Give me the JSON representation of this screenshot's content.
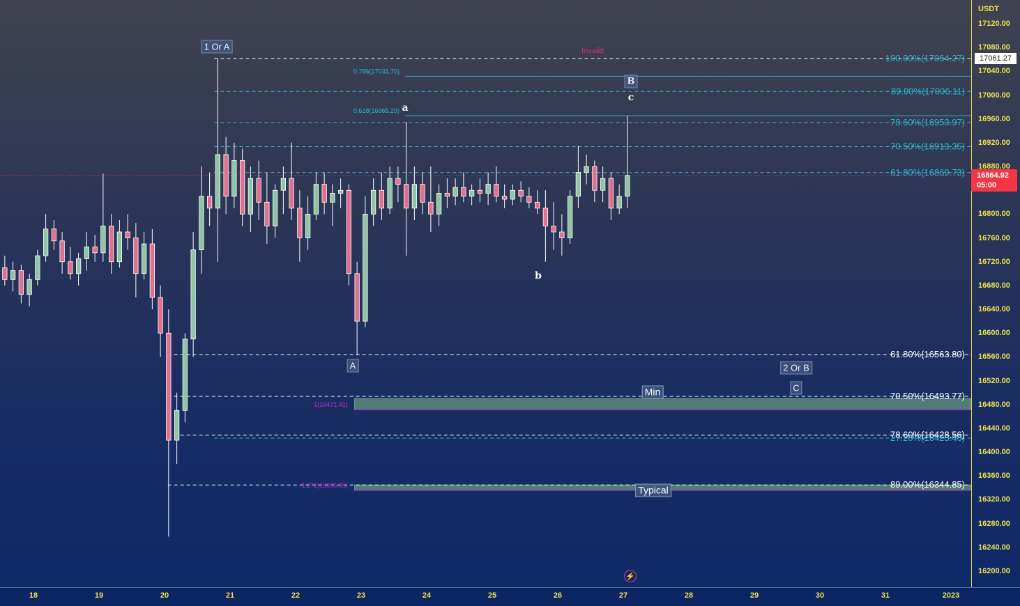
{
  "chart_data": {
    "type": "candlestick",
    "currency": "USDT",
    "candle_interval_days": 0.125,
    "first_candle_start_day": 17.5,
    "ohlc": [
      [
        16710,
        16730,
        16680,
        16690
      ],
      [
        16690,
        16720,
        16670,
        16705
      ],
      [
        16705,
        16715,
        16650,
        16665
      ],
      [
        16665,
        16700,
        16645,
        16690
      ],
      [
        16690,
        16740,
        16680,
        16730
      ],
      [
        16730,
        16800,
        16720,
        16775
      ],
      [
        16775,
        16790,
        16740,
        16755
      ],
      [
        16755,
        16770,
        16700,
        16720
      ],
      [
        16720,
        16745,
        16690,
        16700
      ],
      [
        16700,
        16735,
        16680,
        16725
      ],
      [
        16725,
        16770,
        16705,
        16745
      ],
      [
        16745,
        16765,
        16720,
        16735
      ],
      [
        16735,
        16868,
        16720,
        16780
      ],
      [
        16780,
        16800,
        16700,
        16720
      ],
      [
        16720,
        16790,
        16710,
        16770
      ],
      [
        16770,
        16800,
        16740,
        16760
      ],
      [
        16760,
        16785,
        16660,
        16700
      ],
      [
        16700,
        16770,
        16690,
        16750
      ],
      [
        16750,
        16775,
        16640,
        16660
      ],
      [
        16660,
        16680,
        16560,
        16600
      ],
      [
        16600,
        16640,
        16258,
        16420
      ],
      [
        16420,
        16500,
        16380,
        16470
      ],
      [
        16470,
        16600,
        16450,
        16590
      ],
      [
        16590,
        16770,
        16560,
        16740
      ],
      [
        16740,
        16880,
        16700,
        16830
      ],
      [
        16830,
        16870,
        16780,
        16810
      ],
      [
        16810,
        17061,
        16720,
        16900
      ],
      [
        16900,
        16930,
        16800,
        16830
      ],
      [
        16830,
        16920,
        16810,
        16890
      ],
      [
        16890,
        16910,
        16780,
        16800
      ],
      [
        16800,
        16880,
        16770,
        16860
      ],
      [
        16860,
        16890,
        16790,
        16820
      ],
      [
        16820,
        16870,
        16750,
        16780
      ],
      [
        16780,
        16850,
        16760,
        16840
      ],
      [
        16840,
        16880,
        16800,
        16860
      ],
      [
        16860,
        16920,
        16790,
        16810
      ],
      [
        16810,
        16840,
        16720,
        16760
      ],
      [
        16760,
        16830,
        16740,
        16800
      ],
      [
        16800,
        16870,
        16790,
        16850
      ],
      [
        16850,
        16870,
        16800,
        16820
      ],
      [
        16820,
        16850,
        16780,
        16835
      ],
      [
        16835,
        16860,
        16810,
        16840
      ],
      [
        16840,
        16850,
        16680,
        16700
      ],
      [
        16700,
        16720,
        16563,
        16620
      ],
      [
        16620,
        16830,
        16610,
        16800
      ],
      [
        16800,
        16860,
        16780,
        16840
      ],
      [
        16840,
        16870,
        16790,
        16810
      ],
      [
        16810,
        16880,
        16800,
        16860
      ],
      [
        16860,
        16880,
        16820,
        16850
      ],
      [
        16850,
        16955,
        16730,
        16810
      ],
      [
        16810,
        16880,
        16790,
        16850
      ],
      [
        16850,
        16870,
        16800,
        16820
      ],
      [
        16820,
        16880,
        16770,
        16800
      ],
      [
        16800,
        16850,
        16780,
        16835
      ],
      [
        16835,
        16860,
        16810,
        16830
      ],
      [
        16830,
        16860,
        16815,
        16845
      ],
      [
        16845,
        16870,
        16820,
        16830
      ],
      [
        16830,
        16850,
        16815,
        16840
      ],
      [
        16840,
        16860,
        16820,
        16835
      ],
      [
        16835,
        16870,
        16815,
        16850
      ],
      [
        16850,
        16880,
        16820,
        16830
      ],
      [
        16830,
        16850,
        16810,
        16825
      ],
      [
        16825,
        16850,
        16815,
        16840
      ],
      [
        16840,
        16855,
        16820,
        16830
      ],
      [
        16830,
        16845,
        16810,
        16820
      ],
      [
        16820,
        16840,
        16800,
        16810
      ],
      [
        16810,
        16840,
        16720,
        16780
      ],
      [
        16780,
        16820,
        16740,
        16770
      ],
      [
        16770,
        16800,
        16730,
        16760
      ],
      [
        16760,
        16840,
        16750,
        16830
      ],
      [
        16830,
        16915,
        16810,
        16870
      ],
      [
        16870,
        16900,
        16850,
        16880
      ],
      [
        16880,
        16890,
        16820,
        16840
      ],
      [
        16840,
        16880,
        16820,
        16860
      ],
      [
        16860,
        16870,
        16790,
        16810
      ],
      [
        16810,
        16850,
        16800,
        16830
      ],
      [
        16830,
        16965,
        16810,
        16864.92
      ]
    ],
    "ylim": [
      16180,
      17150
    ],
    "y_ticks": [
      "17120.00",
      "17080.00",
      "17040.00",
      "17000.00",
      "16960.00",
      "16920.00",
      "16880.00",
      "16800.00",
      "16760.00",
      "16720.00",
      "16680.00",
      "16640.00",
      "16600.00",
      "16560.00",
      "16520.00",
      "16480.00",
      "16440.00",
      "16400.00",
      "16360.00",
      "16320.00",
      "16280.00",
      "16240.00",
      "16200.00"
    ],
    "x_ticks": [
      {
        "label": "18",
        "day": 18
      },
      {
        "label": "19",
        "day": 19
      },
      {
        "label": "20",
        "day": 20
      },
      {
        "label": "21",
        "day": 21
      },
      {
        "label": "22",
        "day": 22
      },
      {
        "label": "23",
        "day": 23
      },
      {
        "label": "24",
        "day": 24
      },
      {
        "label": "25",
        "day": 25
      },
      {
        "label": "26",
        "day": 26
      },
      {
        "label": "27",
        "day": 27
      },
      {
        "label": "28",
        "day": 28
      },
      {
        "label": "29",
        "day": 29
      },
      {
        "label": "30",
        "day": 30
      },
      {
        "label": "31",
        "day": 31
      },
      {
        "label": "2023",
        "day": 32
      }
    ],
    "levels": [
      {
        "label": "100.00%(17064.27)",
        "price": 17061.27,
        "from_day": 20.76,
        "style": "dashed",
        "color": "#ffffff",
        "label_color": "#2bb7c9",
        "label_side": "right"
      },
      {
        "label": "89.00%(17006.11)",
        "price": 17006.11,
        "from_day": 20.76,
        "style": "dashed",
        "color": "#2bb7c9",
        "label_color": "#2bb7c9",
        "label_side": "right"
      },
      {
        "label": "78.60%(16953.97)",
        "price": 16953.97,
        "from_day": 20.76,
        "style": "dashed",
        "color": "#2bb7c9",
        "label_color": "#2bb7c9",
        "label_side": "right"
      },
      {
        "label": "70.50%(16913.35)",
        "price": 16913.35,
        "from_day": 20.76,
        "style": "dashed",
        "color": "#2bb7c9",
        "label_color": "#2bb7c9",
        "label_side": "right"
      },
      {
        "label": "61.80%(16869.73)",
        "price": 16869.73,
        "from_day": 20.76,
        "style": "dashed",
        "color": "#2bb7c9",
        "label_color": "#2bb7c9",
        "label_side": "right"
      },
      {
        "label": "61.80%(16563.80)",
        "price": 16563.8,
        "from_day": 20.05,
        "style": "dashed",
        "color": "#ffffff",
        "label_color": "#ffffff",
        "label_side": "right"
      },
      {
        "label": "70.50%(16493.77)",
        "price": 16493.77,
        "from_day": 20.05,
        "style": "dashed",
        "color": "#ffffff",
        "label_color": "#ffffff",
        "label_side": "right"
      },
      {
        "label": "27.20%(16423.46)",
        "price": 16423.46,
        "from_day": 20.76,
        "style": "dashed",
        "color": "#2bb7c9",
        "label_color": "#2bb7c9",
        "label_side": "right"
      },
      {
        "label": "78.60%(16428.56)",
        "price": 16428.56,
        "from_day": 20.05,
        "style": "dashed",
        "color": "#ffffff",
        "label_color": "#ffffff",
        "label_side": "right"
      },
      {
        "label": "89.00%(16344.85)",
        "price": 16344.85,
        "from_day": 20.05,
        "style": "dashed",
        "color": "#ffffff",
        "label_color": "#ffffff",
        "label_side": "right"
      },
      {
        "label": "0.786(17031.70)",
        "price": 17031.7,
        "from_day": 23.67,
        "style": "solid",
        "color": "#2bb7c9",
        "label_color": "#2bb7c9",
        "label_side": "left"
      },
      {
        "label": "0.618(16965.29)",
        "price": 16965.29,
        "from_day": 23.67,
        "style": "solid",
        "color": "#2bb7c9",
        "label_color": "#2bb7c9",
        "label_side": "left"
      },
      {
        "label": "1(16471.41)",
        "price": 16471.41,
        "from_day": 22.88,
        "style": "solid",
        "color": "#c02ad8",
        "label_color": "#c02ad8",
        "label_side": "left"
      },
      {
        "label": "1.272(16335.85)",
        "price": 16335.85,
        "from_day": 22.88,
        "style": "solid",
        "color": "#c02ad8",
        "label_color": "#c02ad8",
        "label_side": "left"
      }
    ],
    "zones": [
      {
        "name": "Min",
        "low": 16471.41,
        "high": 16490,
        "from_day": 22.9
      },
      {
        "name": "Typical",
        "low": 16335.85,
        "high": 16344.85,
        "from_day": 22.9
      }
    ],
    "last_price": 16864.92,
    "last_price_countdown": "05:00",
    "marked_price": "17061.27",
    "colors": {
      "up": "#8fc4a4",
      "down": "#e0708e",
      "wick": "#ffffff",
      "last_line": "#d2306a",
      "zone": "#5a8a7a"
    }
  },
  "annotations": {
    "wave_1_or_a": "1 Or A",
    "invalid": "Invalid",
    "wave_B": "B",
    "wave_c": "c",
    "wave_a": "a",
    "wave_b": "b",
    "wave_A": "A",
    "wave_2_or_b": "2 Or B",
    "wave_C": "C",
    "zone_min": "Min",
    "zone_typical": "Typical"
  },
  "icons": {
    "alert": "lightning-icon"
  }
}
